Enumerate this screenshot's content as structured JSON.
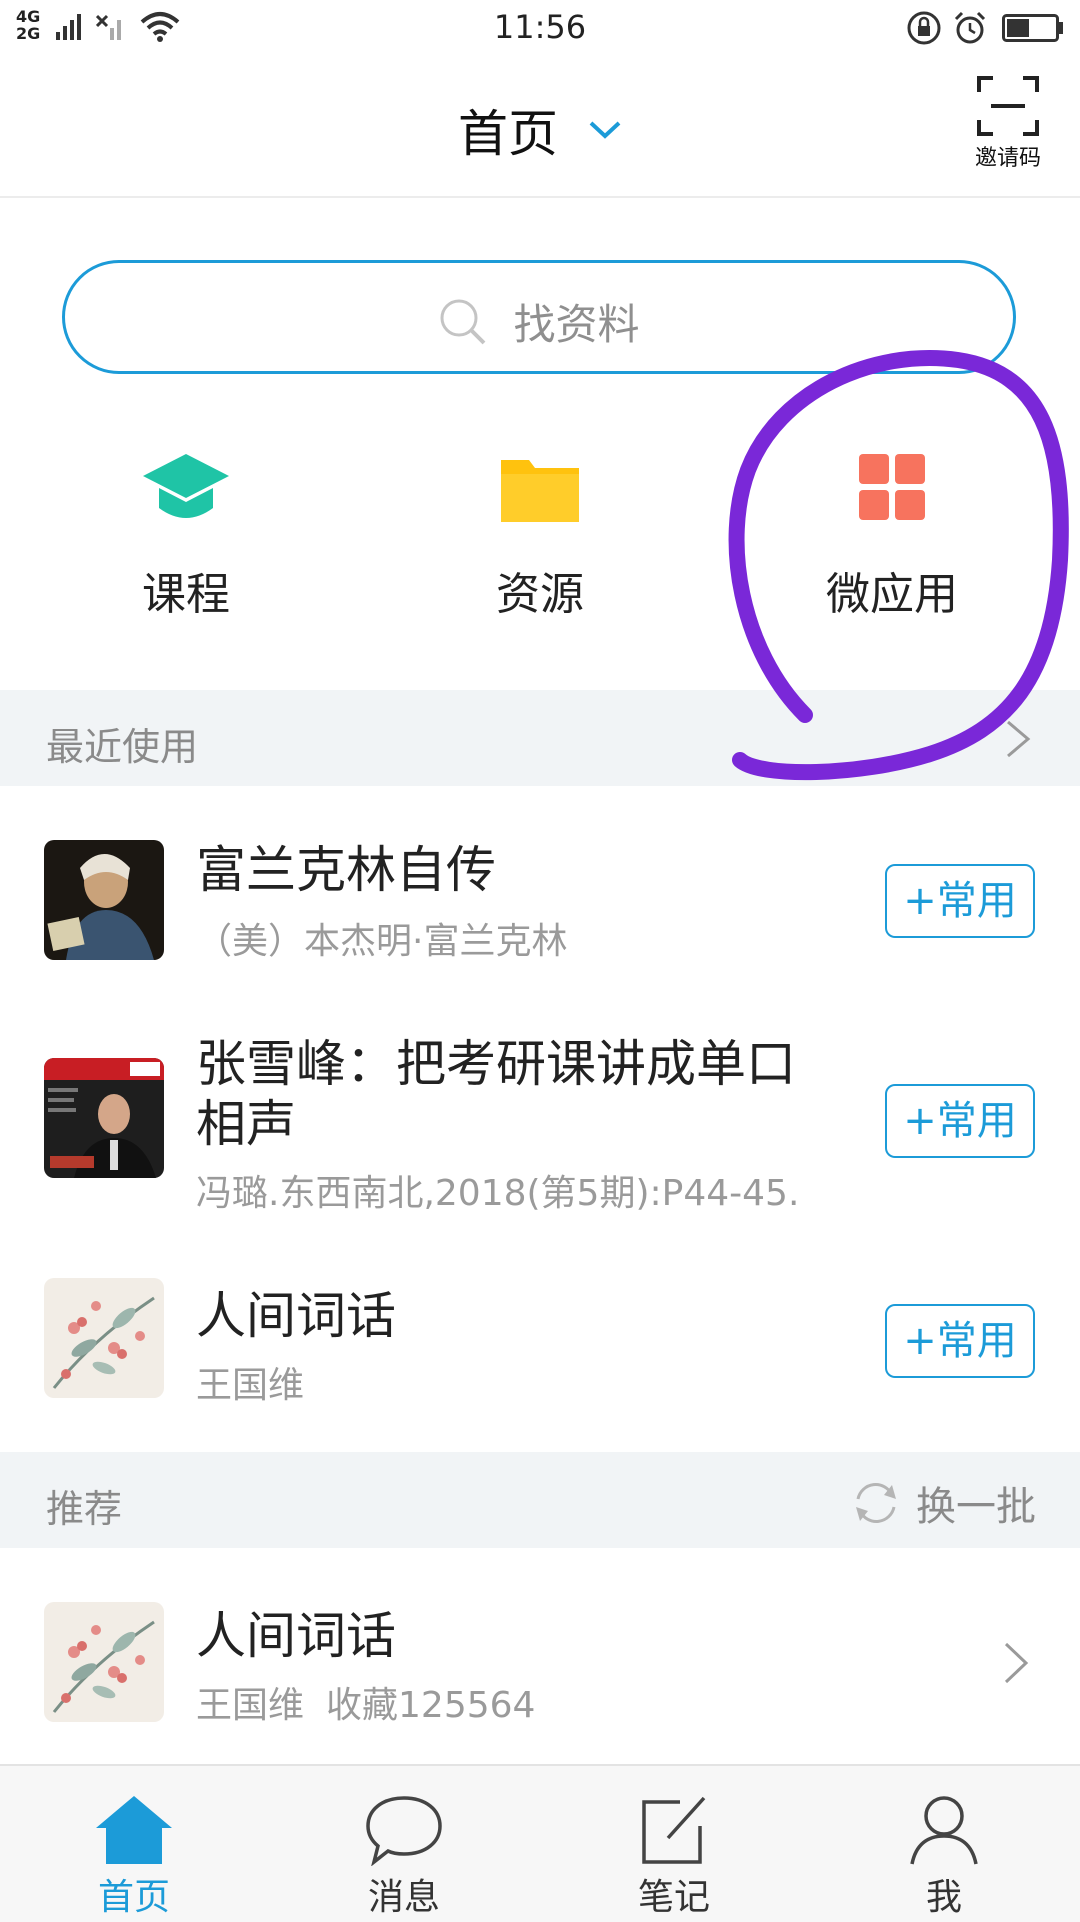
{
  "status_bar": {
    "net_top": "4G",
    "net_bottom": "2G",
    "time": "11:56"
  },
  "header": {
    "title": "首页",
    "scan_label": "邀请码"
  },
  "search": {
    "placeholder": "找资料"
  },
  "quick_entries": [
    {
      "label": "课程",
      "icon": "graduation-cap-icon",
      "color": "#1fc4a6"
    },
    {
      "label": "资源",
      "icon": "folder-icon",
      "color": "#ffc20e"
    },
    {
      "label": "微应用",
      "icon": "app-grid-icon",
      "color": "#f7735e"
    }
  ],
  "recent": {
    "title": "最近使用",
    "items": [
      {
        "title": "富兰克林自传",
        "subtitle": "（美）本杰明·富兰克林",
        "button": "+常用"
      },
      {
        "title": "张雪峰：把考研课讲成单口相声",
        "subtitle": "冯璐.东西南北,2018(第5期):P44-45.",
        "button": "+常用"
      },
      {
        "title": "人间词话",
        "subtitle": "王国维",
        "button": "+常用"
      }
    ]
  },
  "recommend": {
    "title": "推荐",
    "refresh_label": "换一批",
    "items": [
      {
        "title": "人间词话",
        "author": "王国维",
        "favorites": "收藏125564"
      }
    ]
  },
  "tabbar": {
    "items": [
      {
        "label": "首页",
        "icon": "home-icon",
        "active": true
      },
      {
        "label": "消息",
        "icon": "chat-bubble-icon",
        "active": false
      },
      {
        "label": "笔记",
        "icon": "edit-note-icon",
        "active": false
      },
      {
        "label": "我",
        "icon": "user-icon",
        "active": false
      }
    ]
  },
  "colors": {
    "accent": "#1c9bd8",
    "annotation": "#7a28d8",
    "section_bg": "#f1f4f6"
  }
}
